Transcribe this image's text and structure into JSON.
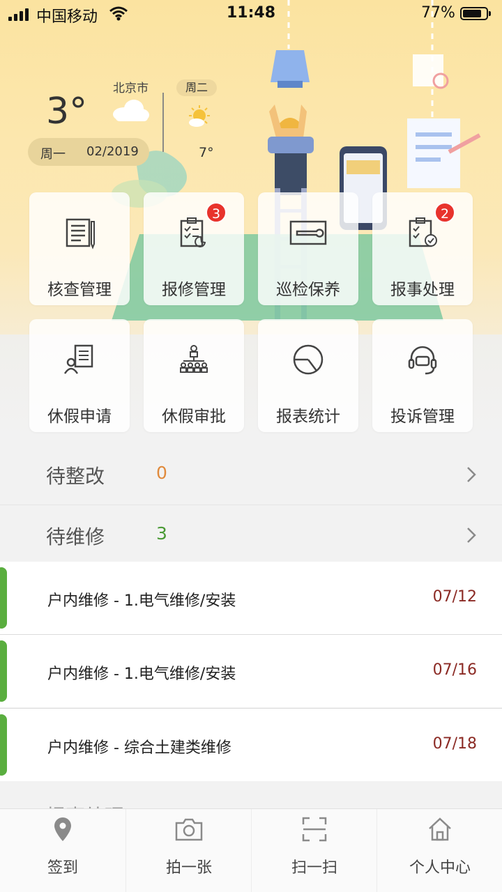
{
  "status_bar": {
    "carrier": "中国移动",
    "time": "11:48",
    "battery": "77%"
  },
  "weather": {
    "temperature": "3°",
    "city": "北京市",
    "weekday": "周一",
    "date": "02/2019",
    "next_day": "周二",
    "next_temp": "7°"
  },
  "grid": {
    "items": [
      {
        "label": "核查管理",
        "icon": "document-icon"
      },
      {
        "label": "报修管理",
        "icon": "repair-checklist-icon",
        "badge": "3"
      },
      {
        "label": "巡检保养",
        "icon": "wrench-icon"
      },
      {
        "label": "报事处理",
        "icon": "checklist-check-icon",
        "badge": "2"
      },
      {
        "label": "休假申请",
        "icon": "leave-request-icon"
      },
      {
        "label": "休假审批",
        "icon": "org-chart-icon"
      },
      {
        "label": "报表统计",
        "icon": "pie-chart-icon"
      },
      {
        "label": "投诉管理",
        "icon": "headset-icon"
      }
    ]
  },
  "summary": {
    "pending_rectify": {
      "label": "待整改",
      "count": "0",
      "color": "#e08a3c"
    },
    "pending_repair": {
      "label": "待维修",
      "count": "3",
      "color": "#4a9a35"
    }
  },
  "repair_list": [
    {
      "title": "户内维修 - 1.电气维修/安装",
      "date": "07/12"
    },
    {
      "title": "户内维修 - 1.电气维修/安装",
      "date": "07/16"
    },
    {
      "title": "户内维修 - 综合土建类维修",
      "date": "07/18"
    }
  ],
  "peek_section": {
    "label": "报事处理"
  },
  "tabbar": {
    "items": [
      {
        "label": "签到",
        "icon": "location-pin-icon"
      },
      {
        "label": "拍一张",
        "icon": "camera-icon"
      },
      {
        "label": "扫一扫",
        "icon": "scan-icon"
      },
      {
        "label": "个人中心",
        "icon": "home-icon"
      }
    ]
  },
  "colors": {
    "accent_green": "#5aae3f",
    "badge_red": "#e8332c",
    "date_red": "#8b2a24",
    "hero_yellow": "#fce7ad"
  }
}
